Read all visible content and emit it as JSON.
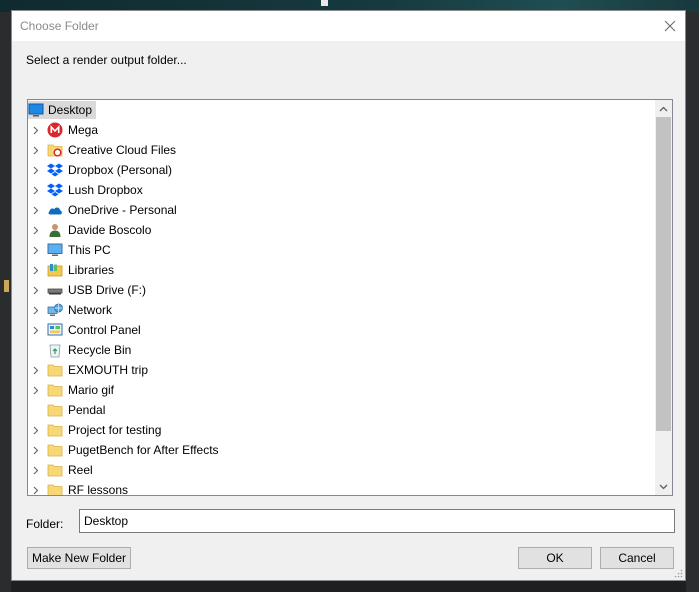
{
  "window": {
    "title": "Choose Folder"
  },
  "prompt": "Select a render output folder...",
  "tree": {
    "root": {
      "label": "Desktop",
      "icon": "desktop-icon"
    },
    "items": [
      {
        "label": "Mega",
        "icon": "mega-icon",
        "expandable": true
      },
      {
        "label": "Creative Cloud Files",
        "icon": "creative-cloud-folder-icon",
        "expandable": true
      },
      {
        "label": "Dropbox (Personal)",
        "icon": "dropbox-icon",
        "expandable": true
      },
      {
        "label": "Lush Dropbox",
        "icon": "dropbox-icon",
        "expandable": true
      },
      {
        "label": "OneDrive - Personal",
        "icon": "onedrive-icon",
        "expandable": true
      },
      {
        "label": "Davide Boscolo",
        "icon": "user-icon",
        "expandable": true
      },
      {
        "label": "This PC",
        "icon": "computer-icon",
        "expandable": true
      },
      {
        "label": "Libraries",
        "icon": "libraries-icon",
        "expandable": true
      },
      {
        "label": "USB Drive (F:)",
        "icon": "usb-drive-icon",
        "expandable": true
      },
      {
        "label": "Network",
        "icon": "network-icon",
        "expandable": true
      },
      {
        "label": "Control Panel",
        "icon": "control-panel-icon",
        "expandable": true
      },
      {
        "label": "Recycle Bin",
        "icon": "recycle-bin-icon",
        "expandable": false
      },
      {
        "label": "EXMOUTH trip",
        "icon": "folder-icon",
        "expandable": true
      },
      {
        "label": "Mario gif",
        "icon": "folder-icon",
        "expandable": true
      },
      {
        "label": "Pendal",
        "icon": "folder-icon",
        "expandable": false
      },
      {
        "label": "Project for testing",
        "icon": "folder-icon",
        "expandable": true
      },
      {
        "label": "PugetBench for After Effects",
        "icon": "folder-icon",
        "expandable": true
      },
      {
        "label": "Reel",
        "icon": "folder-icon",
        "expandable": true
      },
      {
        "label": "RF lessons",
        "icon": "folder-icon",
        "expandable": true
      }
    ]
  },
  "folder": {
    "label": "Folder:",
    "value": "Desktop"
  },
  "buttons": {
    "new_folder": "Make New Folder",
    "ok": "OK",
    "cancel": "Cancel"
  },
  "colors": {
    "selection": "#d9d9d9",
    "folder": "#f8d775",
    "mega": "#d9272e",
    "dropbox": "#0061fe",
    "onedrive": "#0f6cbd"
  }
}
